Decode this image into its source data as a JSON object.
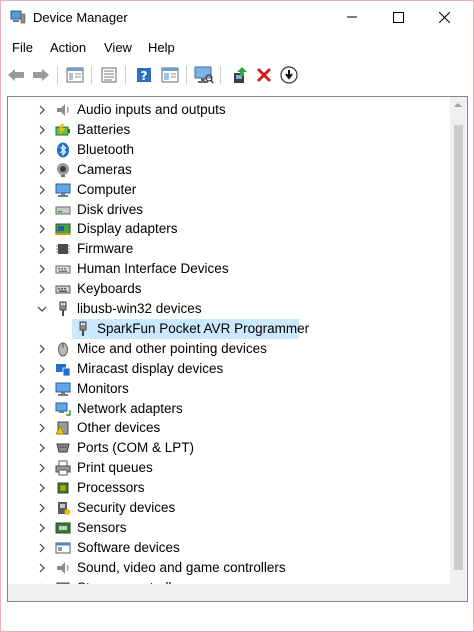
{
  "window": {
    "title": "Device Manager"
  },
  "menu": {
    "file": "File",
    "action": "Action",
    "view": "View",
    "help": "Help"
  },
  "toolbar": {
    "buttons": [
      "back-icon",
      "forward-icon",
      "properties-view-icon",
      "device-list-icon",
      "help-icon",
      "device-view-icon",
      "monitor-scan-icon",
      "update-driver-icon",
      "uninstall-icon",
      "disable-icon"
    ]
  },
  "tree": {
    "items": [
      {
        "label": "Audio inputs and outputs",
        "icon": "speaker-icon",
        "expanded": false
      },
      {
        "label": "Batteries",
        "icon": "battery-icon",
        "expanded": false
      },
      {
        "label": "Bluetooth",
        "icon": "bluetooth-icon",
        "expanded": false
      },
      {
        "label": "Cameras",
        "icon": "camera-icon",
        "expanded": false
      },
      {
        "label": "Computer",
        "icon": "computer-icon",
        "expanded": false
      },
      {
        "label": "Disk drives",
        "icon": "disk-icon",
        "expanded": false
      },
      {
        "label": "Display adapters",
        "icon": "display-adapter-icon",
        "expanded": false
      },
      {
        "label": "Firmware",
        "icon": "firmware-icon",
        "expanded": false
      },
      {
        "label": "Human Interface Devices",
        "icon": "hid-icon",
        "expanded": false
      },
      {
        "label": "Keyboards",
        "icon": "keyboard-icon",
        "expanded": false
      },
      {
        "label": "libusb-win32 devices",
        "icon": "usb-icon",
        "expanded": true
      },
      {
        "label": "SparkFun Pocket AVR Programmer",
        "icon": "usb-device-icon",
        "child": true,
        "selected": true
      },
      {
        "label": "Mice and other pointing devices",
        "icon": "mouse-icon",
        "expanded": false
      },
      {
        "label": "Miracast display devices",
        "icon": "miracast-icon",
        "expanded": false
      },
      {
        "label": "Monitors",
        "icon": "monitor-icon",
        "expanded": false
      },
      {
        "label": "Network adapters",
        "icon": "network-icon",
        "expanded": false
      },
      {
        "label": "Other devices",
        "icon": "other-device-icon",
        "expanded": false
      },
      {
        "label": "Ports (COM & LPT)",
        "icon": "port-icon",
        "expanded": false
      },
      {
        "label": "Print queues",
        "icon": "printer-icon",
        "expanded": false
      },
      {
        "label": "Processors",
        "icon": "processor-icon",
        "expanded": false
      },
      {
        "label": "Security devices",
        "icon": "security-icon",
        "expanded": false
      },
      {
        "label": "Sensors",
        "icon": "sensor-icon",
        "expanded": false
      },
      {
        "label": "Software devices",
        "icon": "software-device-icon",
        "expanded": false
      },
      {
        "label": "Sound, video and game controllers",
        "icon": "sound-icon",
        "expanded": false
      },
      {
        "label": "Storage controllers",
        "icon": "storage-icon",
        "expanded": false
      }
    ]
  },
  "colors": {
    "selection": "#cce8ff",
    "accent": "#0078d7"
  }
}
